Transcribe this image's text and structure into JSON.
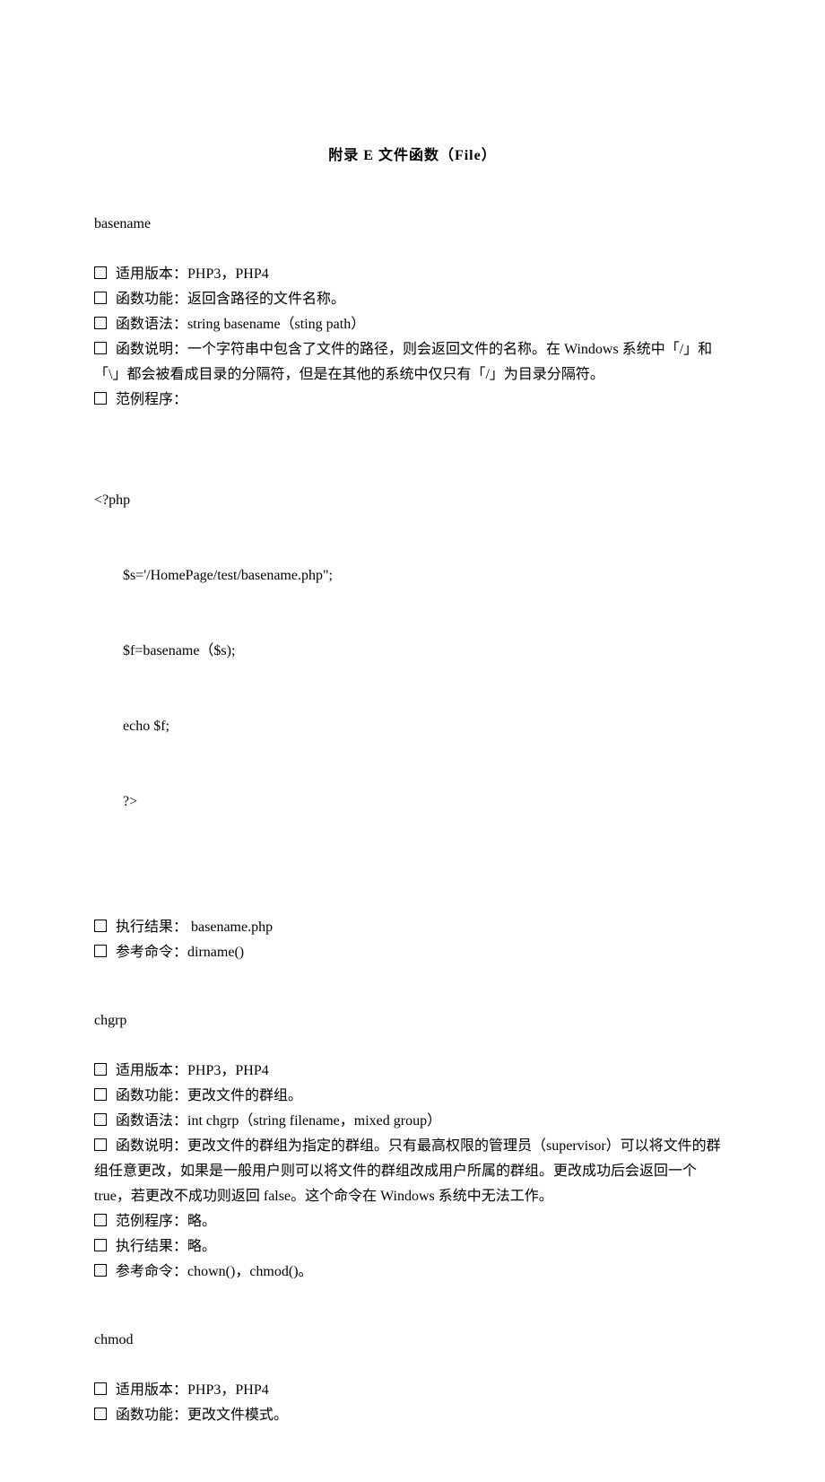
{
  "title": "附录 E  文件函数（File）",
  "functions": {
    "basename": {
      "name": "basename",
      "version_label": "适用版本：",
      "version_value": "PHP3，PHP4",
      "feature_label": "函数功能：",
      "feature_value": "返回含路径的文件名称。",
      "syntax_label": "函数语法：",
      "syntax_value": "string basename（sting path）",
      "desc_label": "函数说明：",
      "desc_value": "一个字符串中包含了文件的路径，则会返回文件的名称。在 Windows 系统中「/」和「\\」都会被看成目录的分隔符，但是在其他的系统中仅只有「/」为目录分隔符。",
      "example_label": "范例程序：",
      "code_line1": "<?php",
      "code_line2": "$s='/HomePage/test/basename.php\";",
      "code_line3": "$f=basename（$s);",
      "code_line4": "echo $f;",
      "code_line5": "?>",
      "result_label": "执行结果：",
      "result_value": " basename.php",
      "see_label": "参考命令：",
      "see_value": "dirname()"
    },
    "chgrp": {
      "name": "chgrp",
      "version_label": "适用版本：",
      "version_value": "PHP3，PHP4",
      "feature_label": "函数功能：",
      "feature_value": "更改文件的群组。",
      "syntax_label": "函数语法：",
      "syntax_value": "int chgrp（string filename，mixed group）",
      "desc_label": "函数说明：",
      "desc_value": "更改文件的群组为指定的群组。只有最高权限的管理员（supervisor）可以将文件的群组任意更改，如果是一般用户则可以将文件的群组改成用户所属的群组。更改成功后会返回一个 true，若更改不成功则返回 false。这个命令在 Windows 系统中无法工作。",
      "example_label": "范例程序：",
      "example_value": "略。",
      "result_label": "执行结果：",
      "result_value": "略。",
      "see_label": "参考命令：",
      "see_value": "chown()，chmod()。"
    },
    "chmod": {
      "name": "chmod",
      "version_label": "适用版本：",
      "version_value": "PHP3，PHP4",
      "feature_label": "函数功能：",
      "feature_value": "更改文件模式。"
    }
  }
}
